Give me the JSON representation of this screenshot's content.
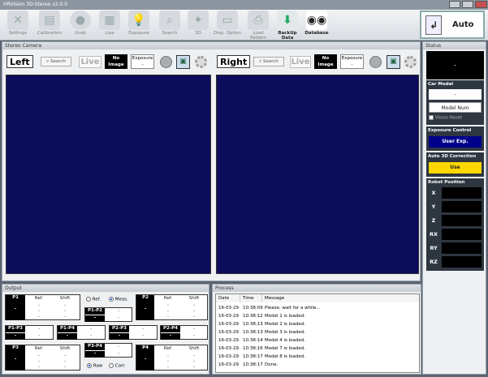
{
  "window": {
    "title": "HRVision 3D-Stereo v2.0.0"
  },
  "toolbar": {
    "items": [
      {
        "label": "Settings",
        "icon": "wrench-icon"
      },
      {
        "label": "Calibration",
        "icon": "ruler-icon"
      },
      {
        "label": "Grab",
        "icon": "grab-icon"
      },
      {
        "label": "Live",
        "icon": "film-icon"
      },
      {
        "label": "Exposure",
        "icon": "bulb-icon"
      },
      {
        "label": "Search",
        "icon": "magnifier-icon"
      },
      {
        "label": "3D",
        "icon": "wand-icon"
      },
      {
        "label": "Disp. Option",
        "icon": "monitor-icon"
      },
      {
        "label": "Load Pattern",
        "icon": "printer-icon"
      },
      {
        "label": "BackUp Data",
        "icon": "backup-icon"
      },
      {
        "label": "Database",
        "icon": "eyes-icon"
      }
    ],
    "auto_label": "Auto"
  },
  "stereo": {
    "title": "Stereo Camera",
    "left": {
      "name": "Left",
      "search": "Search",
      "live": "Live",
      "no_image_1": "No",
      "no_image_2": "Image",
      "exposure_label": "Exposure",
      "exposure_value": "-"
    },
    "right": {
      "name": "Right",
      "search": "Search",
      "live": "Live",
      "no_image_1": "No",
      "no_image_2": "Image",
      "exposure_label": "Exposure",
      "exposure_value": "-"
    }
  },
  "status": {
    "title": "Status",
    "display": "-",
    "car_model": {
      "title": "Car Model",
      "value": "-",
      "model_num": "Model Num",
      "vision_reset": "Vision Reset"
    },
    "exposure_control": {
      "title": "Exposure Control",
      "value": "User Exp."
    },
    "auto3d": {
      "title": "Auto 3D Correction",
      "value": "Use"
    },
    "robot": {
      "title": "Robot Position",
      "axes": [
        "X",
        "Y",
        "Z",
        "RX",
        "RY",
        "RZ"
      ]
    }
  },
  "output": {
    "title": "Output",
    "ref": "Ref.",
    "shift": "Shift",
    "dash": "-",
    "radio_ref": "Ref.",
    "radio_meas": "Meas.",
    "radio_raw": "Raw",
    "radio_corr": "Corr.",
    "p1": "P1",
    "p2": "P2",
    "p3": "P3",
    "p4": "P4",
    "p1p2": "P1-P2",
    "p3p4": "P3-P4",
    "p1p3": "P1-P3",
    "p1p4": "P1-P4",
    "p2p3": "P2-P3",
    "p2p4": "P2-P4"
  },
  "process": {
    "title": "Process",
    "headers": {
      "date": "Date",
      "time": "Time",
      "message": "Message"
    },
    "rows": [
      {
        "date": "16-03-29",
        "time": "10:38:09",
        "msg": "Please, wait for a while..."
      },
      {
        "date": "16-03-29",
        "time": "10:38:12",
        "msg": "Model 1 is loaded."
      },
      {
        "date": "16-03-29",
        "time": "10:38:13",
        "msg": "Model 2 is loaded."
      },
      {
        "date": "16-03-29",
        "time": "10:38:13",
        "msg": "Model 3 is loaded."
      },
      {
        "date": "16-03-29",
        "time": "10:38:14",
        "msg": "Model 4 is loaded."
      },
      {
        "date": "16-03-29",
        "time": "10:38:16",
        "msg": "Model 7 is loaded."
      },
      {
        "date": "16-03-29",
        "time": "10:38:17",
        "msg": "Model 8 is loaded."
      },
      {
        "date": "16-03-29",
        "time": "10:38:17",
        "msg": "Done."
      }
    ]
  }
}
